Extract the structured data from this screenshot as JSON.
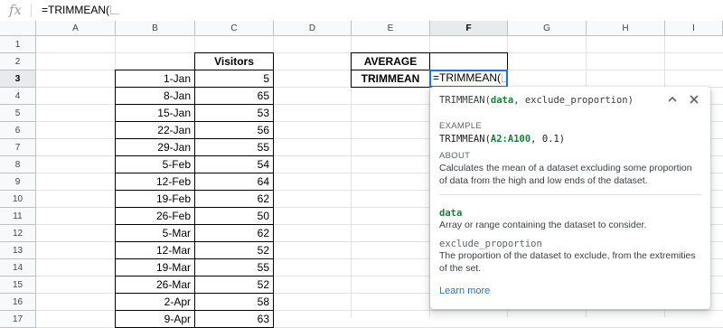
{
  "formula_bar": {
    "fx_label": "fx",
    "content": "=TRIMMEAN("
  },
  "columns": [
    "A",
    "B",
    "C",
    "D",
    "E",
    "F",
    "G",
    "H",
    "I"
  ],
  "rows": [
    "1",
    "2",
    "3",
    "4",
    "5",
    "6",
    "7",
    "8",
    "9",
    "10",
    "11",
    "12",
    "13",
    "14",
    "15",
    "16",
    "17"
  ],
  "sheet": {
    "visitors_header": "Visitors",
    "dates": [
      "1-Jan",
      "8-Jan",
      "15-Jan",
      "22-Jan",
      "29-Jan",
      "5-Feb",
      "12-Feb",
      "19-Feb",
      "26-Feb",
      "5-Mar",
      "12-Mar",
      "19-Mar",
      "26-Mar",
      "2-Apr",
      "9-Apr"
    ],
    "visitors": [
      "5",
      "65",
      "53",
      "56",
      "55",
      "54",
      "64",
      "62",
      "50",
      "62",
      "52",
      "55",
      "52",
      "58",
      "63"
    ],
    "average_label": "AVERAGE",
    "trimmean_label": "TRIMMEAN",
    "editing_value": "=TRIMMEAN("
  },
  "help_popup": {
    "signature_fn": "TRIMMEAN(",
    "signature_arg1": "data",
    "signature_rest": ", exclude_proportion)",
    "example_heading": "EXAMPLE",
    "example_fn": "TRIMMEAN(",
    "example_arg": "A2:A100",
    "example_rest": ", 0.1)",
    "about_heading": "ABOUT",
    "about_text": "Calculates the mean of a dataset excluding some proportion of data from the high and low ends of the dataset.",
    "arg1_name": "data",
    "arg1_desc": "Array or range containing the dataset to consider.",
    "arg2_name": "exclude_proportion",
    "arg2_desc": "The proportion of the dataset to exclude, from the extremities of the set.",
    "learn_more": "Learn more",
    "collapse_icon": "chevron-up-icon",
    "close_icon": "close-icon"
  },
  "colors": {
    "accent": "#1a73e8",
    "arg_highlight": "#188038"
  }
}
